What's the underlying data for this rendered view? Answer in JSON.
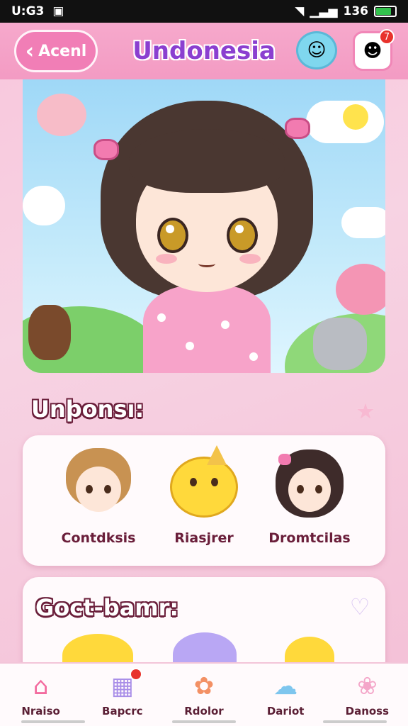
{
  "status_bar": {
    "time": "U:G3",
    "battery": "136"
  },
  "header": {
    "back_label": "Acenl",
    "title": "Undonesia"
  },
  "icons": {
    "back": "chevron-left-icon",
    "chat": "chat-bubble-icon",
    "notification": "notification-icon",
    "favorite_star": "star-icon",
    "favorite_heart": "heart-icon"
  },
  "notification_badge": "7",
  "section1": {
    "title": "Unþonsı:",
    "characters": [
      {
        "name": "Contdksis"
      },
      {
        "name": "Riasjrer"
      },
      {
        "name": "Dromtcilas"
      }
    ]
  },
  "section2": {
    "title": "Goct-bamr:"
  },
  "tabs": [
    {
      "label": "Nraiso",
      "icon": "home-icon"
    },
    {
      "label": "Bapcrc",
      "icon": "box-icon",
      "badge": ""
    },
    {
      "label": "Rdolor",
      "icon": "palette-icon"
    },
    {
      "label": "Dariot",
      "icon": "cloud-icon"
    },
    {
      "label": "Danoss",
      "icon": "flower-icon"
    }
  ],
  "colors": {
    "accent": "#f17eb6",
    "title": "#8b3fd0",
    "text_dark": "#6a1e3a",
    "badge": "#e8322c"
  }
}
